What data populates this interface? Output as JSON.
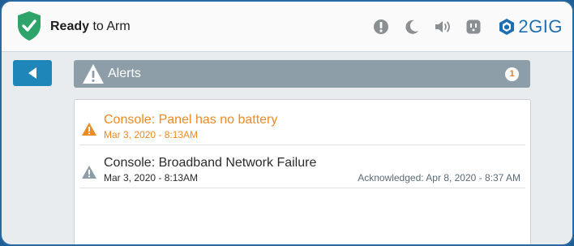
{
  "header": {
    "status_bold": "Ready",
    "status_rest": " to Arm",
    "brand": "2GIG",
    "icons": [
      "shield-check-icon",
      "alert-icon",
      "moon-icon",
      "volume-icon",
      "outlet-icon",
      "2gig-logo-icon"
    ]
  },
  "colors": {
    "header_bg": "#fafafa",
    "frame_bg": "#1f5f95",
    "back_button": "#1f86b9",
    "alerts_bar": "#8e9ea8",
    "alert_orange": "#ef8a23",
    "shield_green": "#2ea36a"
  },
  "alerts_bar": {
    "title": "Alerts",
    "count": "1"
  },
  "alerts": [
    {
      "title": "Console: Panel has no battery",
      "date": "Mar 3, 2020 - 8:13AM",
      "acknowledged": ""
    },
    {
      "title": "Console: Broadband Network Failure",
      "date": "Mar 3, 2020 - 8:13AM",
      "acknowledged": "Acknowledged: Apr 8, 2020 - 8:37 AM"
    }
  ]
}
